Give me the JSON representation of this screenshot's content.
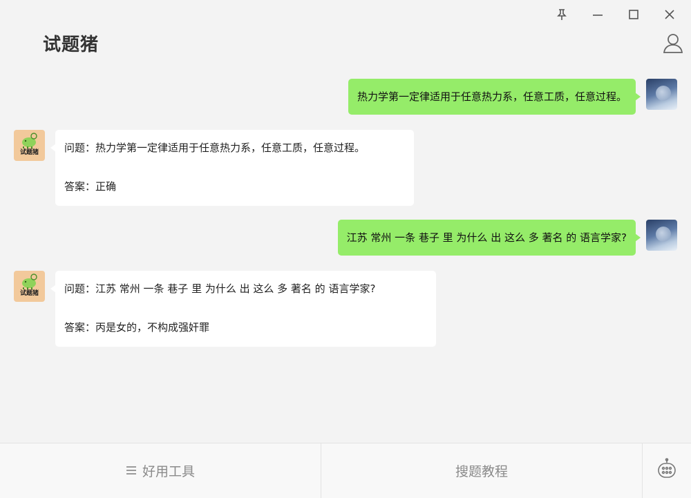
{
  "window": {
    "controls": [
      {
        "name": "pin-icon"
      },
      {
        "name": "minimize-icon"
      },
      {
        "name": "maximize-icon"
      },
      {
        "name": "close-icon"
      }
    ]
  },
  "header": {
    "title": "试题猪",
    "user_icon": "user-icon"
  },
  "chat": {
    "messages": [
      {
        "role": "user",
        "text": "热力学第一定律适用于任意热力系，任意工质，任意过程。"
      },
      {
        "role": "bot",
        "question": "问题：热力学第一定律适用于任意热力系，任意工质，任意过程。",
        "answer": "答案：正确",
        "avatar_label": "试题猪"
      },
      {
        "role": "user",
        "text": "江苏 常州 一条 巷子 里 为什么 出 这么 多 著名 的 语言学家?"
      },
      {
        "role": "bot",
        "question": "问题：江苏 常州 一条 巷子 里 为什么 出 这么 多 著名 的 语言学家?",
        "answer": "答案：丙是女的，不构成强奸罪",
        "avatar_label": "试题猪"
      }
    ]
  },
  "bottom_bar": {
    "tools_label": "好用工具",
    "tutorial_label": "搜题教程",
    "robot_icon": "robot-icon"
  },
  "colors": {
    "user_bubble": "#95ec69",
    "bot_bubble": "#ffffff",
    "background": "#f3f3f3"
  }
}
